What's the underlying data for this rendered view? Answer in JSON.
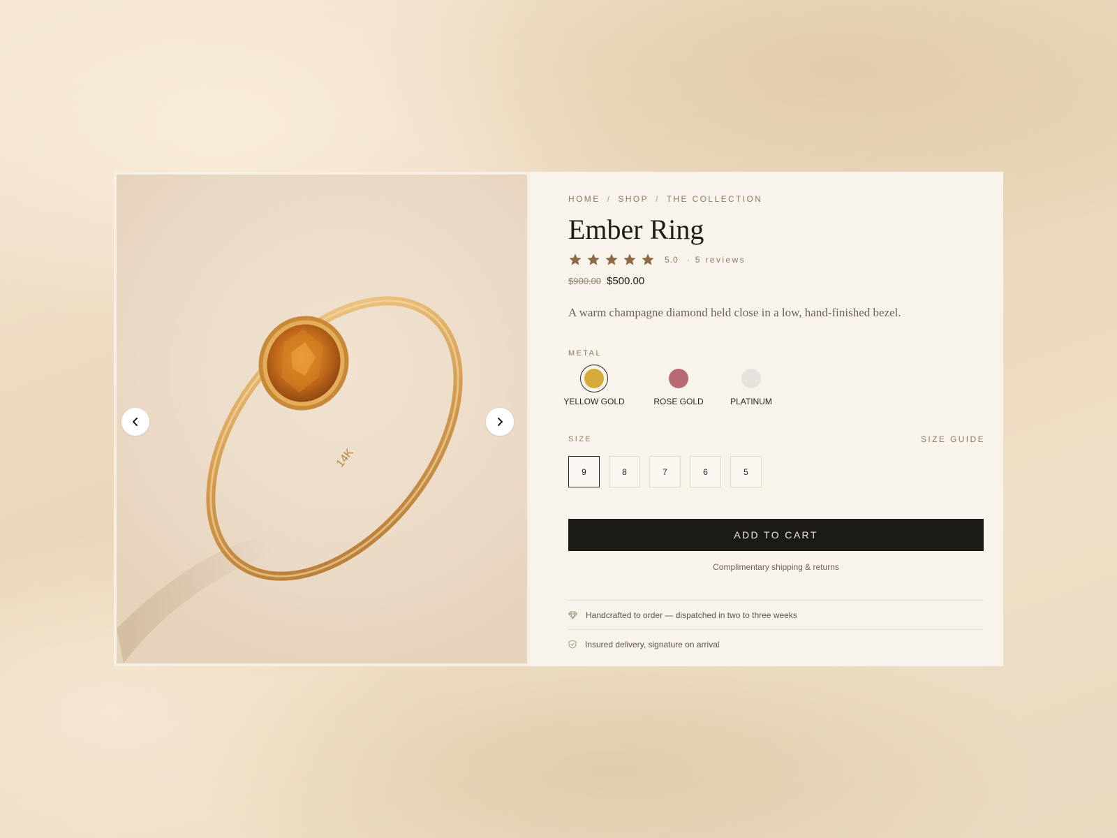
{
  "breadcrumb": {
    "items": [
      "HOME",
      "SHOP",
      "THE COLLECTION"
    ],
    "separator": "/"
  },
  "product": {
    "title": "Ember Ring",
    "rating": {
      "stars": 5,
      "value": "5.0",
      "dot": "·",
      "reviews": "5 reviews"
    },
    "price_old": "$900.00",
    "price_new": "$500.00",
    "description": "A warm champagne diamond held close in a low, hand-finished bezel."
  },
  "gallery": {
    "prev_icon": "chevron-left-icon",
    "next_icon": "chevron-right-icon"
  },
  "metal": {
    "label": "METAL",
    "options": [
      {
        "name": "YELLOW GOLD",
        "color": "#d4ab3a",
        "selected": true
      },
      {
        "name": "ROSE GOLD",
        "color": "#b86a74",
        "selected": false
      },
      {
        "name": "PLATINUM",
        "color": "#e6e3df",
        "selected": false
      }
    ]
  },
  "size": {
    "label": "SIZE",
    "guide": "SIZE GUIDE",
    "options": [
      "9",
      "8",
      "7",
      "6",
      "5"
    ],
    "selected": "9"
  },
  "cart": {
    "button": "ADD TO CART",
    "shipping": "Complimentary shipping & returns"
  },
  "features": [
    {
      "icon": "diamond-icon",
      "text": "Handcrafted to order — dispatched in two to three weeks"
    },
    {
      "icon": "shield-icon",
      "text": "Insured delivery, signature on arrival"
    }
  ],
  "colors": {
    "accent_star": "#8c6a44",
    "button_bg": "#1c1a17",
    "panel_bg": "#f8f3eb"
  }
}
